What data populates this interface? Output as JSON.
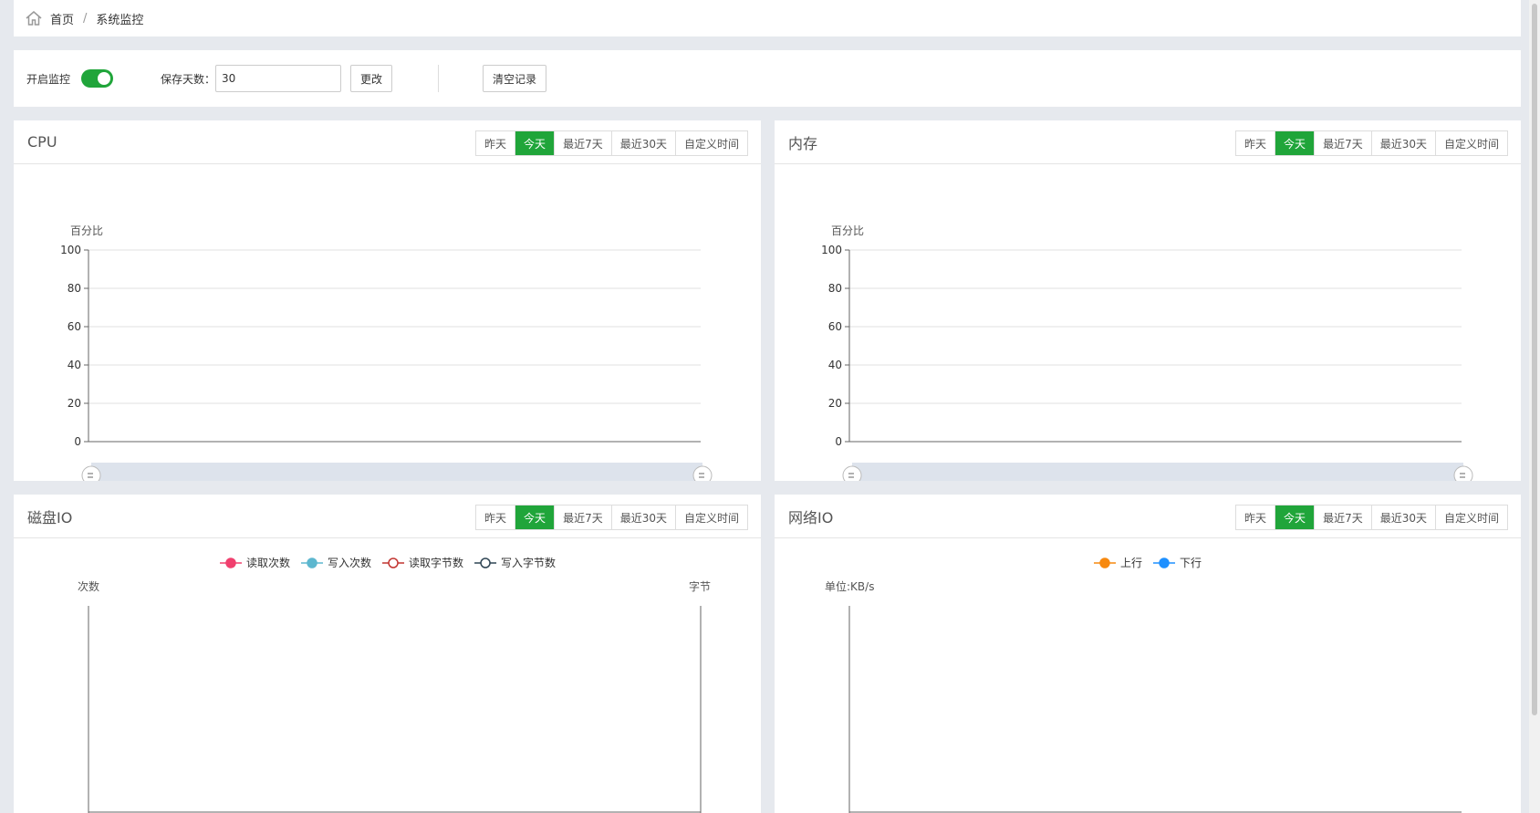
{
  "breadcrumb": {
    "home": "首页",
    "separator": "/",
    "current": "系统监控"
  },
  "settings": {
    "monitor_label": "开启监控",
    "monitor_enabled": true,
    "days_label": "保存天数：",
    "days_value": "30",
    "change_button": "更改",
    "clear_button": "清空记录"
  },
  "range_buttons": [
    "昨天",
    "今天",
    "最近7天",
    "最近30天",
    "自定义时间"
  ],
  "active_range": "今天",
  "panels": {
    "cpu": {
      "title": "CPU",
      "chart_data": {
        "type": "line",
        "ylabel": "百分比",
        "ylim": [
          0,
          100
        ],
        "yticks": [
          "100",
          "80",
          "60",
          "40",
          "20",
          "0"
        ],
        "series": []
      }
    },
    "memory": {
      "title": "内存",
      "chart_data": {
        "type": "line",
        "ylabel": "百分比",
        "ylim": [
          0,
          100
        ],
        "yticks": [
          "100",
          "80",
          "60",
          "40",
          "20",
          "0"
        ],
        "series": []
      }
    },
    "disk": {
      "title": "磁盘IO",
      "chart_data": {
        "type": "line",
        "ylabel": "次数",
        "ylabel_right": "字节",
        "legend": [
          {
            "name": "读取次数",
            "color": "#f0406e",
            "filled": true
          },
          {
            "name": "写入次数",
            "color": "#5db7cf",
            "filled": true
          },
          {
            "name": "读取字节数",
            "color": "#c23531",
            "filled": false
          },
          {
            "name": "写入字节数",
            "color": "#2f4554",
            "filled": false
          }
        ],
        "series": []
      }
    },
    "network": {
      "title": "网络IO",
      "chart_data": {
        "type": "line",
        "ylabel": "单位:KB/s",
        "legend": [
          {
            "name": "上行",
            "color": "#f7890f",
            "filled": true
          },
          {
            "name": "下行",
            "color": "#1e90ff",
            "filled": true
          }
        ],
        "series": []
      }
    }
  }
}
